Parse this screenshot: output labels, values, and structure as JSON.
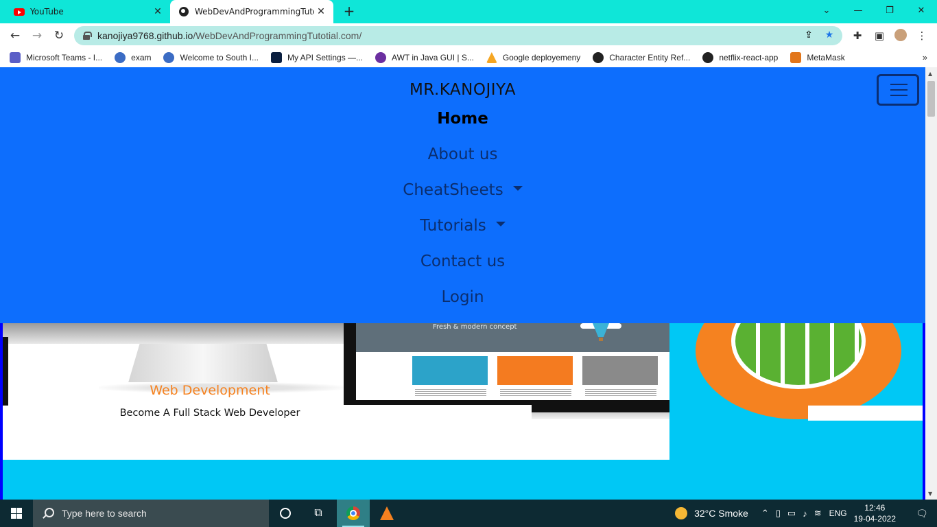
{
  "browser": {
    "tabs": [
      {
        "title": "YouTube",
        "icon": "youtube-icon",
        "active": false
      },
      {
        "title": "WebDevAndProgrammingTutorial",
        "icon": "globe-icon",
        "active": true
      }
    ],
    "new_tab_symbol": "+",
    "window_controls": {
      "tab_search": "⌄",
      "minimize": "—",
      "restore": "❐",
      "close": "✕"
    },
    "url_host": "kanojiya9768.github.io",
    "url_path": "/WebDevAndProgrammingTutotial.com/",
    "bookmarks": [
      {
        "label": "Microsoft Teams - I...",
        "color": "#5b5fc7"
      },
      {
        "label": "exam",
        "color": "#3b6cc4"
      },
      {
        "label": "Welcome to South I...",
        "color": "#3b6cc4"
      },
      {
        "label": "My API Settings —...",
        "color": "#0b1f3f"
      },
      {
        "label": "AWT in Java GUI | S...",
        "color": "#6b2fa0"
      },
      {
        "label": "Google deployemeny",
        "color": "#f5a623"
      },
      {
        "label": "Character Entity Ref...",
        "color": "#222222"
      },
      {
        "label": "netflix-react-app",
        "color": "#222222"
      },
      {
        "label": "MetaMask",
        "color": "#e2761b"
      }
    ],
    "bookmarks_more": "»"
  },
  "site": {
    "brand": "MR.KANOJIYA",
    "nav": {
      "home": "Home",
      "about": "About us",
      "cheatsheets": "CheatSheets",
      "tutorials": "Tutorials",
      "contact": "Contact us",
      "login": "Login"
    },
    "hero": {
      "title": "Web Development",
      "subtitle": "Become A Full Stack Web Developer",
      "banner_text": "Fresh & modern concept"
    },
    "colors": {
      "navbar": "#0d6efd",
      "accent": "#f58220",
      "page_bg": "#00c8f5"
    }
  },
  "taskbar": {
    "search_placeholder": "Type here to search",
    "weather": "32°C  Smoke",
    "language": "ENG",
    "time": "12:46",
    "date": "19-04-2022"
  }
}
